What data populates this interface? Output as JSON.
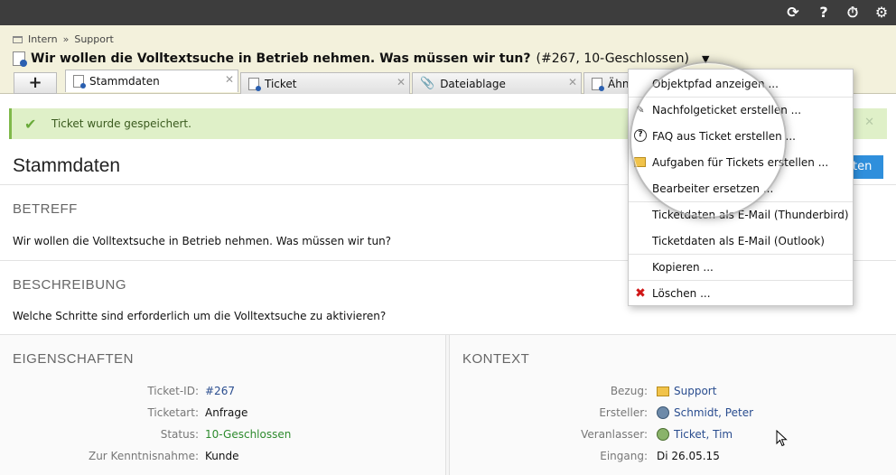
{
  "topbar": {
    "icons": [
      {
        "name": "sync-icon",
        "glyph": "⟳"
      },
      {
        "name": "help-icon",
        "glyph": "?"
      },
      {
        "name": "timer-icon",
        "glyph": "⏱"
      },
      {
        "name": "gear-icon",
        "glyph": "⚙"
      }
    ]
  },
  "breadcrumb": {
    "items": [
      "Intern",
      "Support"
    ],
    "separator": "»"
  },
  "ticket": {
    "title": "Wir wollen die Volltextsuche in Betrieb nehmen. Was müssen wir tun?",
    "meta": "(#267, 10-Geschlossen)",
    "dropdown": "▼"
  },
  "tabs": {
    "add": "+",
    "items": [
      {
        "label": "Stammdaten",
        "close": "✕"
      },
      {
        "label": "Ticket",
        "close": "✕"
      },
      {
        "label": "Dateiablage",
        "close": "✕"
      },
      {
        "label": "Ähnl",
        "close": ""
      }
    ]
  },
  "notice": {
    "text": "Ticket wurde gespeichert.",
    "check": "✔",
    "close": "✕"
  },
  "page": {
    "title": "Stammdaten",
    "edit_button": "ten"
  },
  "betreff": {
    "heading": "BETREFF",
    "text": "Wir wollen die Volltextsuche in Betrieb nehmen. Was müssen wir tun?"
  },
  "beschreibung": {
    "heading": "BESCHREIBUNG",
    "text": "Welche Schritte sind erforderlich um die Volltextsuche zu aktivieren?"
  },
  "eigenschaften": {
    "heading": "EIGENSCHAFTEN",
    "rows": [
      {
        "label": "Ticket-ID:",
        "value": "#267"
      },
      {
        "label": "Ticketart:",
        "value": "Anfrage"
      },
      {
        "label": "Status:",
        "value": "10-Geschlossen"
      },
      {
        "label": "Zur Kenntnisnahme:",
        "value": "Kunde"
      }
    ]
  },
  "kontext": {
    "heading": "KONTEXT",
    "rows": [
      {
        "label": "Bezug:",
        "value": "Support"
      },
      {
        "label": "Ersteller:",
        "value": "Schmidt, Peter"
      },
      {
        "label": "Veranlasser:",
        "value": "Ticket, Tim"
      },
      {
        "label": "Eingang:",
        "value": "Di 26.05.15"
      }
    ]
  },
  "menu": {
    "items": [
      {
        "label": "Objektpfad anzeigen ..."
      },
      {
        "label": "Nachfolgeticket erstellen ...",
        "icon": "✎"
      },
      {
        "label": "FAQ aus Ticket erstellen ...",
        "icon": "?"
      },
      {
        "label": "Aufgaben für Tickets erstellen ..."
      },
      {
        "label": "Bearbeiter ersetzen ..."
      },
      {
        "label": "Ticketdaten als E-Mail (Thunderbird)"
      },
      {
        "label": "Ticketdaten als E-Mail (Outlook)"
      },
      {
        "label": "Kopieren ..."
      },
      {
        "label": "Löschen ...",
        "icon": "✖"
      }
    ]
  },
  "colors": {
    "accent": "#2f8fdc",
    "success_bg": "#dff0c8",
    "header_bg": "#f3f1dc",
    "status_green": "#2e8b2e",
    "link_blue": "#2a4d8f",
    "delete_red": "#d01616"
  }
}
